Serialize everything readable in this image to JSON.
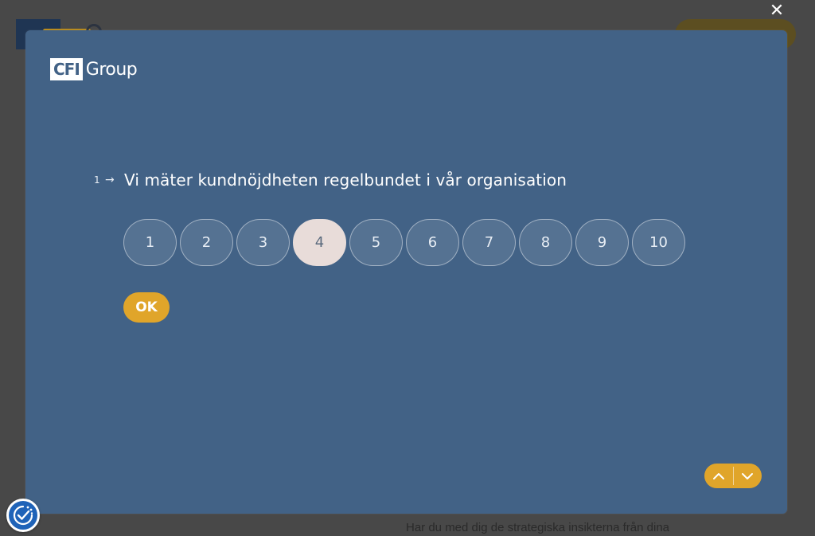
{
  "background": {
    "bottom_text": "Har du med dig de strategiska insikterna från dina"
  },
  "modal": {
    "close_icon": "close-icon",
    "brand": {
      "box_text": "CFI",
      "word": "Group"
    },
    "question": {
      "number": "1",
      "arrow": "→",
      "text": "Vi mäter kundnöjdheten regelbundet i vår organisation"
    },
    "scale": {
      "options": [
        "1",
        "2",
        "3",
        "4",
        "5",
        "6",
        "7",
        "8",
        "9",
        "10"
      ],
      "selected": "4"
    },
    "ok_label": "OK",
    "nav": {
      "up_icon": "chevron-up-icon",
      "down_icon": "chevron-down-icon"
    }
  },
  "colors": {
    "modal_bg": "#426286",
    "accent": "#e0a52a",
    "selected_option": "#e8dcd9",
    "overlay": "#484848"
  },
  "accessibility_button_icon": "accessibility-icon"
}
